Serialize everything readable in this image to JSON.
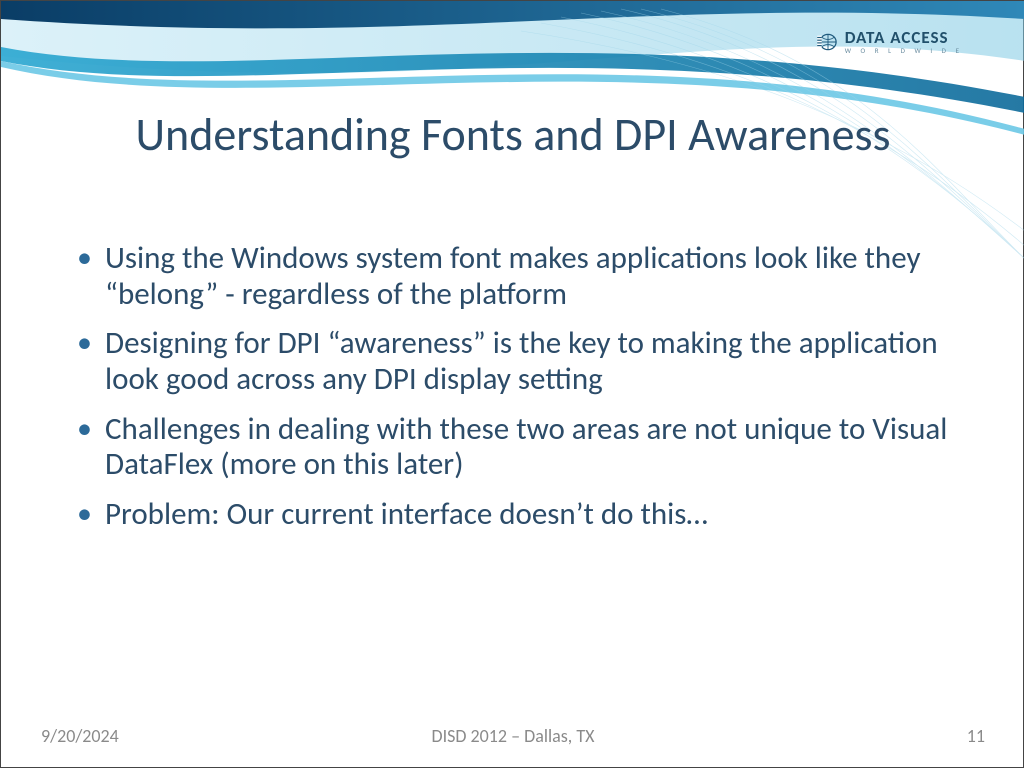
{
  "logo": {
    "main": "DATA ACCESS",
    "sub": "W O R L D W I D E"
  },
  "title": "Understanding Fonts and DPI Awareness",
  "bullets": [
    "Using the Windows system font makes applications look like they “belong” - regardless of the platform",
    "Designing for DPI “awareness” is the key to making the application look good across any DPI display setting",
    "Challenges in dealing with these two areas are not unique to Visual DataFlex (more on this later)",
    "Problem: Our current interface doesn’t do this…"
  ],
  "footer": {
    "date": "9/20/2024",
    "event": "DISD 2012 – Dallas, TX",
    "page": "11"
  }
}
